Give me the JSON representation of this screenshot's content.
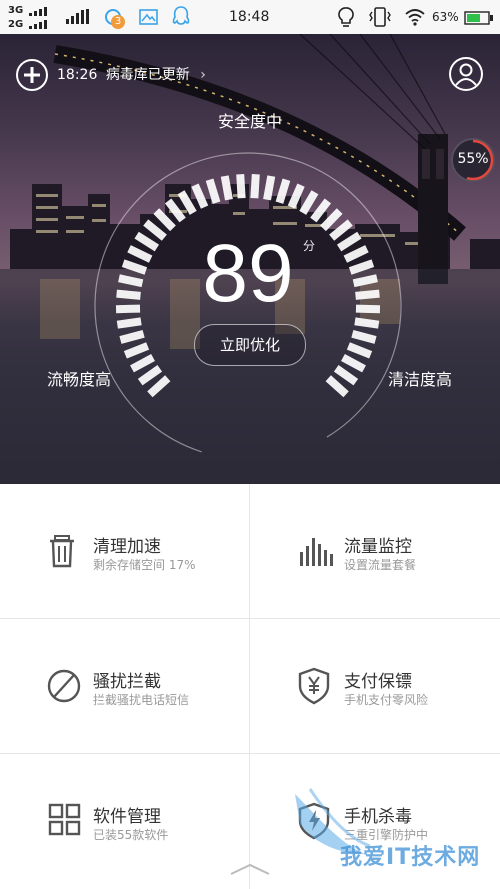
{
  "status_bar": {
    "network_top": "3G",
    "network_bottom": "2G",
    "notification_badge": "3",
    "time": "18:48",
    "battery_percent": "63%",
    "icons": [
      "signal-icon",
      "signal-icon",
      "qq-browser-icon",
      "image-icon",
      "qq-icon",
      "bulb-icon",
      "vibrate-icon",
      "wifi-icon",
      "battery-icon"
    ]
  },
  "hero": {
    "update_time": "18:26",
    "update_text": "病毒库已更新",
    "safety_label": "安全度中",
    "score": "89",
    "score_unit": "分",
    "optimize_button": "立即优化",
    "left_metric": "流畅度高",
    "right_metric": "清洁度高",
    "memory_percent": "55%"
  },
  "tiles": [
    {
      "title": "清理加速",
      "subtitle": "剩余存储空间 17%",
      "icon": "trash-icon"
    },
    {
      "title": "流量监控",
      "subtitle": "设置流量套餐",
      "icon": "traffic-bars-icon"
    },
    {
      "title": "骚扰拦截",
      "subtitle": "拦截骚扰电话短信",
      "icon": "block-icon"
    },
    {
      "title": "支付保镖",
      "subtitle": "手机支付零风险",
      "icon": "yuan-shield-icon"
    },
    {
      "title": "软件管理",
      "subtitle": "已装55款软件",
      "icon": "apps-grid-icon"
    },
    {
      "title": "手机杀毒",
      "subtitle": "三重引擎防护中",
      "icon": "bolt-shield-icon"
    }
  ],
  "watermark": "我爱IT技术网"
}
